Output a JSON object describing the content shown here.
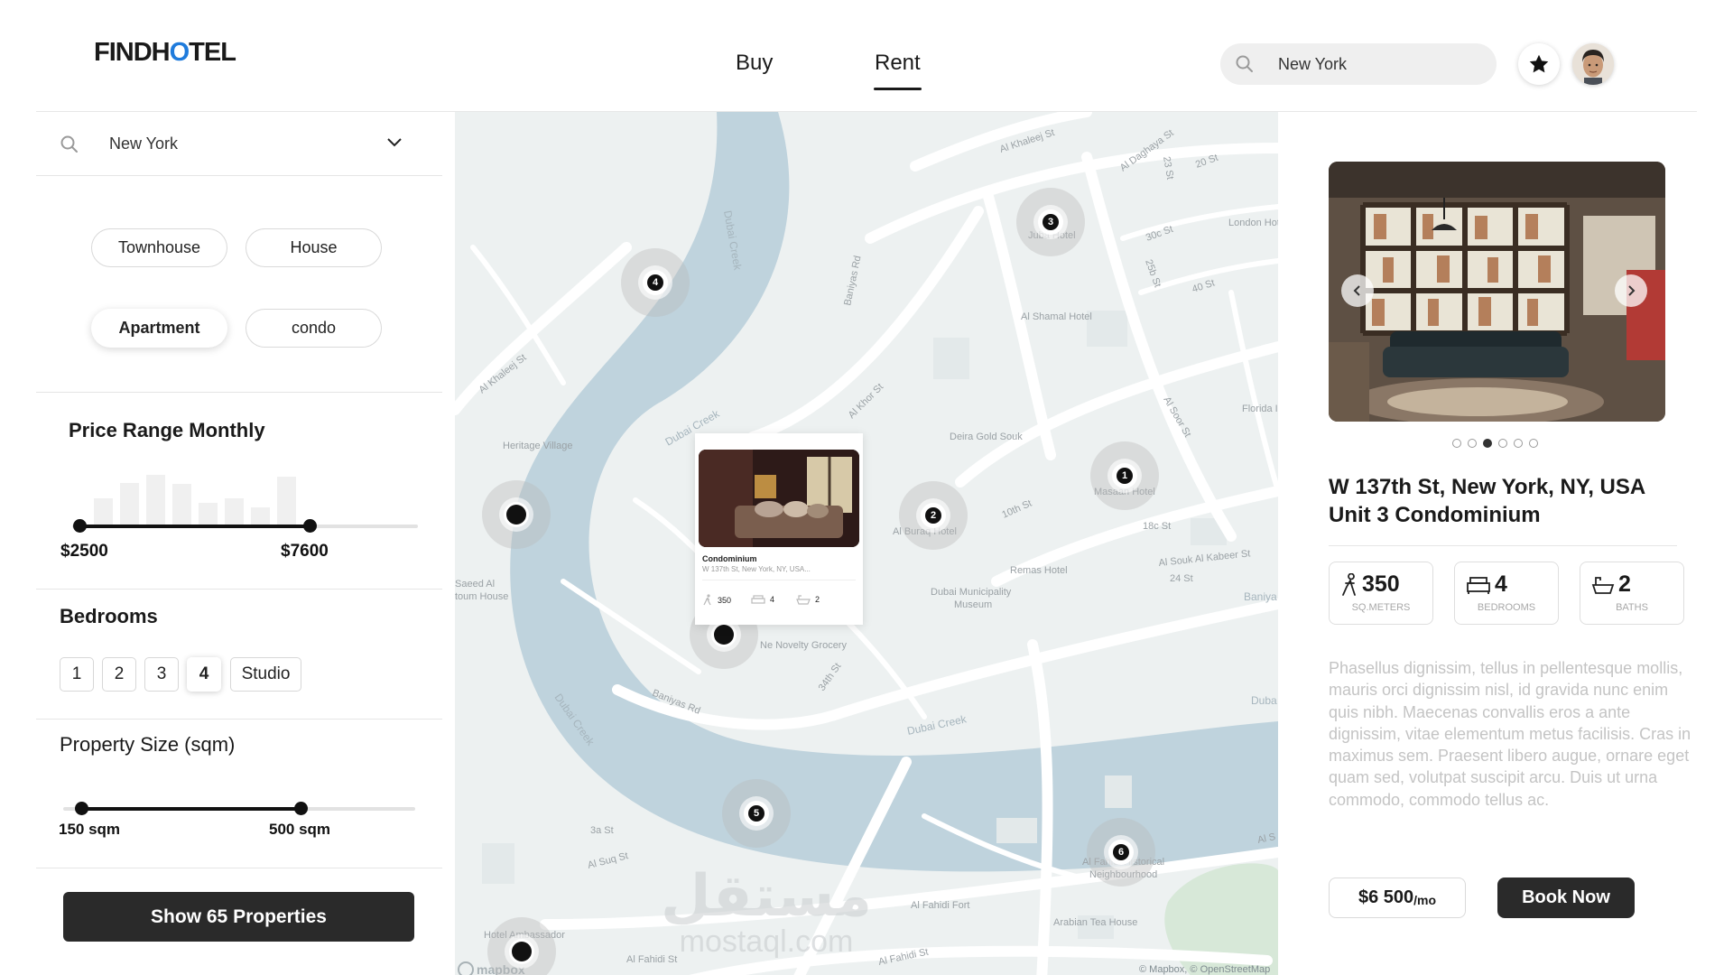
{
  "header": {
    "logo_left": "FINDH",
    "logo_accent": "O",
    "logo_right": "TEL",
    "nav_buy": "Buy",
    "nav_rent": "Rent",
    "search_value": "New York"
  },
  "filters": {
    "location": "New York",
    "property_types": [
      {
        "label": "Townhouse",
        "active": false
      },
      {
        "label": "House",
        "active": false
      },
      {
        "label": "Apartment",
        "active": true
      },
      {
        "label": "condo",
        "active": false
      }
    ],
    "price_title": "Price Range Monthly",
    "price_min": "$2500",
    "price_max": "$7600",
    "bedrooms_title": "Bedrooms",
    "bedrooms": [
      {
        "label": "1",
        "active": false
      },
      {
        "label": "2",
        "active": false
      },
      {
        "label": "3",
        "active": false
      },
      {
        "label": "4",
        "active": true
      },
      {
        "label": "Studio",
        "active": false
      }
    ],
    "size_title": "Property Size (sqm)",
    "size_min": "150 sqm",
    "size_max": "500 sqm",
    "show_button": "Show 65 Properties"
  },
  "map": {
    "labels": {
      "al_khaleej_st_1": "Al Khaleej St",
      "al_khaleej_st_2": "Al Khaleej St",
      "al_daghaya_st": "Al Daghaya St",
      "st_23": "23 St",
      "st_20": "20 St",
      "london_hotel": "London Hot",
      "juba_hotel": "Juba Hotel",
      "st_30c": "30c St",
      "st_25b": "25b St",
      "st_40": "40 St",
      "al_shamal_hotel": "Al Shamal Hotel",
      "baniyas_rd_1": "Baniyas Rd",
      "dubai_creek_1": "Dubai Creek",
      "dubai_creek_2": "Dubai Creek",
      "heritage_village": "Heritage Village",
      "al_khor_st": "Al Khor St",
      "deira_gold_souk": "Deira Gold Souk",
      "al_soor_st": "Al Soor St",
      "florida": "Florida I",
      "masaan_hotel": "Masaan Hotel",
      "st_10th": "10th St",
      "st_18c": "18c St",
      "al_buraq_hotel": "Al Buraq Hotel",
      "remas_hotel": "Remas Hotel",
      "al_souk_al_kabeer_st": "Al Souk Al Kabeer St",
      "st_24": "24 St",
      "saeed_al": "Saeed Al",
      "toum_house": "toum House",
      "dubai_municipality": "Dubai Municipality",
      "museum": "Museum",
      "baniya": "Baniya",
      "ne_novelty_grocery": "Ne Novelty Grocery",
      "st_34th": "34th St",
      "dubai_creek_3": "Dubai Creek",
      "baniyas_rd_2": "Baniyas Rd",
      "dubai_creek_4": "Dubai Creek",
      "dubai_creek_5": "Duba",
      "st_3a": "3a St",
      "al_suq_st": "Al Suq St",
      "al_fahidi_historical": "Al Fahidi Historical",
      "neighbourhood": "Neighbourhood",
      "al_fahidi_fort": "Al Fahidi Fort",
      "arabian_tea_house": "Arabian Tea House",
      "hotel_ambassador": "Hotel Ambassador",
      "al_fahidi_st_1": "Al Fahidi St",
      "al_fahidi_st_2": "Al Fahidi St",
      "al_s": "Al S"
    },
    "clusters": [
      "3",
      "4",
      "1",
      "2",
      "5",
      "6"
    ],
    "popup": {
      "title": "Condominium",
      "address": "W 137th  St, New York, NY,  USA...",
      "area": "350",
      "bedrooms": "4",
      "baths": "2"
    },
    "logo": "mapbox",
    "attribution": "© Mapbox, © OpenStreetMap",
    "watermark_top": "مستقل",
    "watermark_bottom": "mostaql.com"
  },
  "listing": {
    "gallery_count": 6,
    "gallery_active": 3,
    "title_line1": "W 137th  St, New York, NY,  USA",
    "title_line2": "Unit 3 Condominium",
    "area_value": "350",
    "area_label": "SQ.METERS",
    "bedrooms_value": "4",
    "bedrooms_label": "BEDROOMS",
    "baths_value": "2",
    "baths_label": "BATHS",
    "description": "Phasellus dignissim, tellus in pellentesque mollis, mauris orci dignissim nisl, id gravida nunc enim quis nibh. Maecenas convallis eros a ante dignissim, vitae elementum metus facilisis. Cras in maximus sem. Praesent libero augue, ornare eget quam sed, volutpat suscipit arcu. Duis ut urna commodo, commodo tellus ac.",
    "price": "$6 500",
    "price_unit": "/mo",
    "book_button": "Book Now"
  },
  "colors": {
    "accent": "#1f7bdc",
    "dark": "#2a2a2a",
    "water": "#bfd3dd",
    "land": "#edf1f1"
  }
}
